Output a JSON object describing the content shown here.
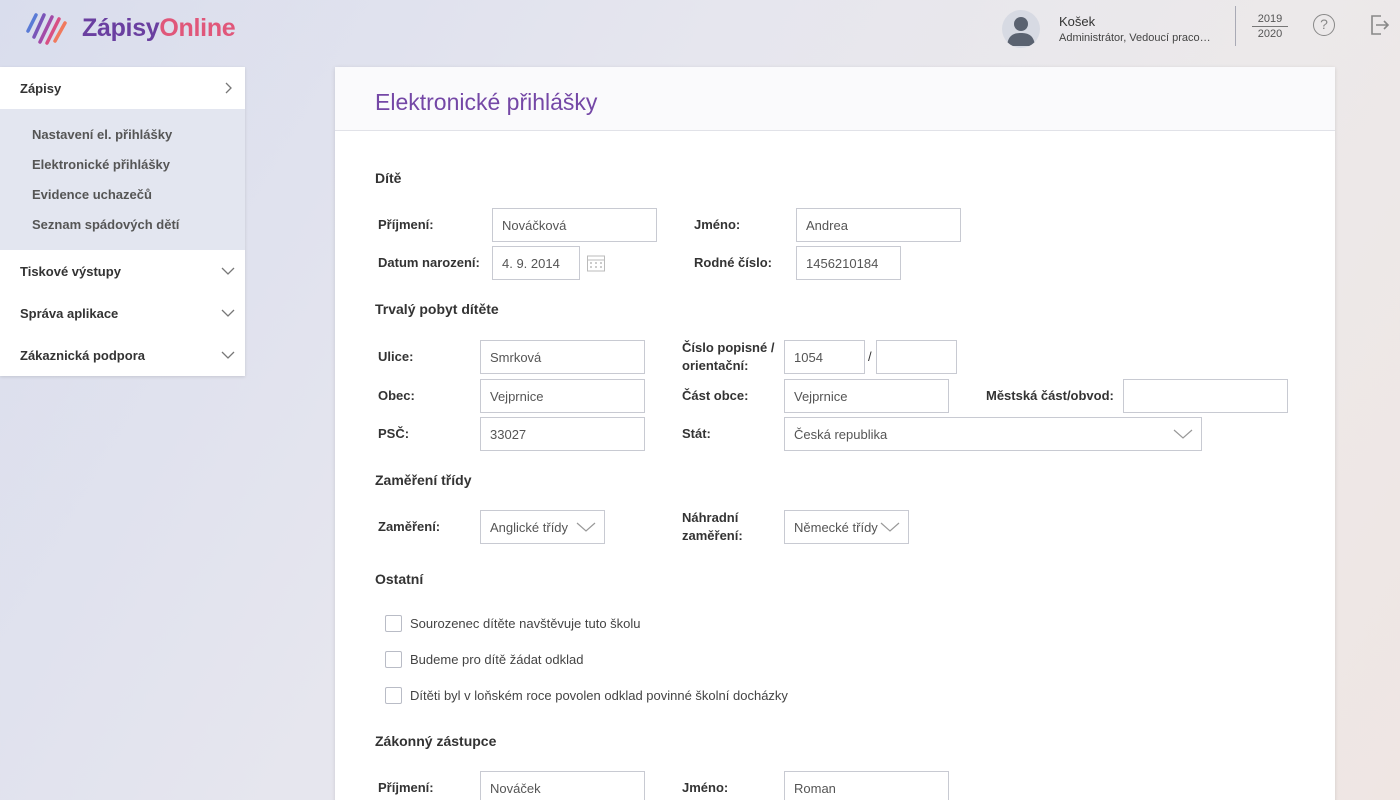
{
  "app": {
    "logo_part1": "Zápisy",
    "logo_part2": "Online"
  },
  "user": {
    "name": "Košek",
    "role": "Administrátor, Vedoucí pracoviště",
    "year_top": "2019",
    "year_bottom": "2020"
  },
  "header_icons": {
    "help": "question-circle-icon",
    "logout": "logout-icon"
  },
  "sidebar": {
    "zapisy": "Zápisy",
    "sub_items": [
      "Nastavení el. přihlášky",
      "Elektronické přihlášky",
      "Evidence uchazečů",
      "Seznam spádových dětí"
    ],
    "tiskove": "Tiskové výstupy",
    "sprava": "Správa aplikace",
    "podpora": "Zákaznická podpora"
  },
  "page": {
    "title": "Elektronické přihlášky"
  },
  "child": {
    "section": "Dítě",
    "surname_label": "Příjmení:",
    "surname": "Nováčková",
    "name_label": "Jméno:",
    "name": "Andrea",
    "birth_label": "Datum narození:",
    "birth": "4. 9. 2014",
    "rc_label": "Rodné číslo:",
    "rc": "1456210184"
  },
  "address": {
    "section": "Trvalý pobyt dítěte",
    "street_label": "Ulice:",
    "street": "Smrková",
    "cp_label": "Číslo popisné / orientační:",
    "cp": "1054",
    "co": "",
    "slash": "/",
    "city_label": "Obec:",
    "city": "Vejprnice",
    "part_label": "Část obce:",
    "part": "Vejprnice",
    "district_label": "Městská část/obvod:",
    "district": "",
    "zip_label": "PSČ:",
    "zip": "33027",
    "state_label": "Stát:",
    "state": "Česká republika"
  },
  "focus": {
    "section": "Zaměření třídy",
    "focus_label": "Zaměření:",
    "focus_value": "Anglické třídy",
    "alt_label": "Náhradní zaměření:",
    "alt_value": "Německé třídy"
  },
  "other": {
    "section": "Ostatní",
    "checkboxes": [
      "Sourozenec dítěte navštěvuje tuto školu",
      "Budeme pro dítě žádat odklad",
      "Dítěti byl v loňském roce povolen odklad povinné školní docházky"
    ]
  },
  "guardian": {
    "section": "Zákonný zástupce",
    "surname_label": "Příjmení:",
    "surname": "Nováček",
    "name_label": "Jméno:",
    "name": "Roman"
  }
}
